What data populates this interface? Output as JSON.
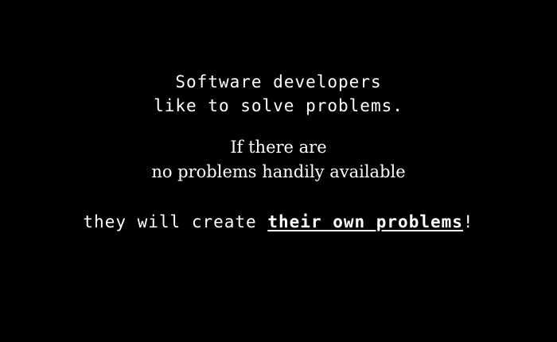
{
  "slide": {
    "line1": "Software developers",
    "line2": "like to solve problems.",
    "line3": "If there are",
    "line4": "no problems handily available",
    "line5_prefix": "they will create ",
    "line5_emphasis": "their own problems",
    "line5_suffix": "!"
  }
}
